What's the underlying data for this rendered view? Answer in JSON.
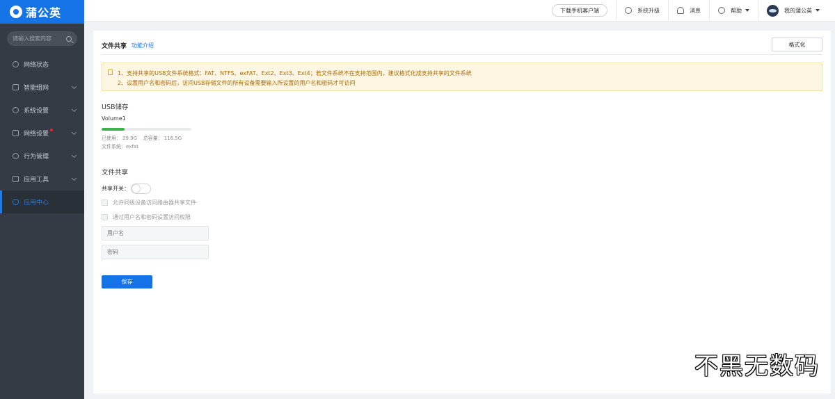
{
  "brand": {
    "name": "蒲公英",
    "color": "#1473e6"
  },
  "sidebar": {
    "search_placeholder": "请输入搜索内容",
    "items": [
      {
        "label": "网络状态",
        "icon": "network-status-icon",
        "has_chevron": false
      },
      {
        "label": "智能组网",
        "icon": "smart-networking-icon",
        "has_chevron": true
      },
      {
        "label": "系统设置",
        "icon": "gear-icon",
        "has_chevron": true
      },
      {
        "label": "网络设置",
        "icon": "network-settings-icon",
        "has_chevron": true,
        "badge_dot": true
      },
      {
        "label": "行为管理",
        "icon": "behavior-icon",
        "has_chevron": true
      },
      {
        "label": "应用工具",
        "icon": "toolbox-icon",
        "has_chevron": true
      },
      {
        "label": "应用中心",
        "icon": "app-center-icon",
        "has_chevron": false,
        "active": true
      }
    ]
  },
  "topbar": {
    "download_label": "下载手机客户端",
    "upgrade_label": "系统升级",
    "message_label": "消息",
    "help_label": "帮助",
    "user_label": "我的蒲公英"
  },
  "panel": {
    "title": "文件共享",
    "intro_link": "功能介绍",
    "format_button": "格式化",
    "notice": [
      "1、支持共享的USB文件系统格式：FAT、NTFS、exFAT、Ext2、Ext3、Ext4；若文件系统不在支持范围内，建议格式化成支持共享的文件系统",
      "2、设置用户名和密码后，访问USB存储文件的所有设备需要输入所设置的用户名和密码才可访问"
    ],
    "usb": {
      "section_title": "USB储存",
      "volume_name": "Volume1",
      "used_label": "已使用：",
      "used_value": "29.9G",
      "total_label": "总容量：",
      "total_value": "116.5G",
      "used_fraction": 0.257,
      "fs_label": "文件系统：",
      "fs_value": "exfat"
    },
    "share": {
      "section_title": "文件共享",
      "switch_label": "共享开关：",
      "switch_on": false,
      "option1": "允许同级设备访问路由器共享文件",
      "option2": "通过用户名和密码设置访问权限",
      "username_placeholder": "用户名",
      "password_placeholder": "密码",
      "save_label": "保存"
    }
  },
  "watermark": "不黑无数码"
}
